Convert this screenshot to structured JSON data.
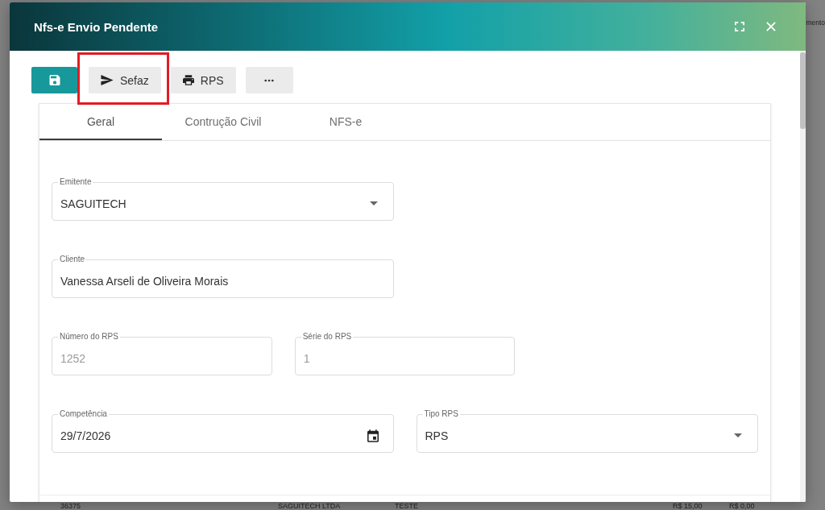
{
  "dialog": {
    "title": "Nfs-e Envio Pendente"
  },
  "toolbar": {
    "buttons": [
      {
        "kind": "save",
        "primary": true,
        "highlighted": false
      },
      {
        "kind": "send",
        "label": "Sefaz",
        "primary": false,
        "highlighted": true
      },
      {
        "kind": "print",
        "label": "RPS",
        "primary": false,
        "highlighted": false
      },
      {
        "kind": "more",
        "primary": false,
        "highlighted": false
      }
    ]
  },
  "tabs": [
    {
      "label": "Geral",
      "selected": true
    },
    {
      "label": "Contrução Civil",
      "selected": false
    },
    {
      "label": "NFS-e",
      "selected": false
    }
  ],
  "form": {
    "rows": [
      [
        {
          "kind": "select",
          "label": "Emitente",
          "value": "SAGUITECH",
          "disabled": false
        }
      ],
      [
        {
          "kind": "text",
          "label": "Cliente",
          "value": "Vanessa Arseli de Oliveira Morais",
          "disabled": false
        }
      ],
      [
        {
          "kind": "text",
          "label": "Número do RPS",
          "value": "1252",
          "disabled": true
        },
        {
          "kind": "text",
          "label": "Série do RPS",
          "value": "1",
          "disabled": true
        }
      ],
      [
        {
          "kind": "date",
          "label": "Competência",
          "value": "29/7/2026",
          "disabled": false
        },
        {
          "kind": "select",
          "label": "Tipo RPS",
          "value": "RPS",
          "disabled": false
        }
      ]
    ]
  },
  "background": {
    "header_fragment": "mento",
    "row": [
      "36375",
      "SAGUITECH LTDA",
      "TESTE",
      "R$ 15,00",
      "R$ 0,00"
    ]
  }
}
